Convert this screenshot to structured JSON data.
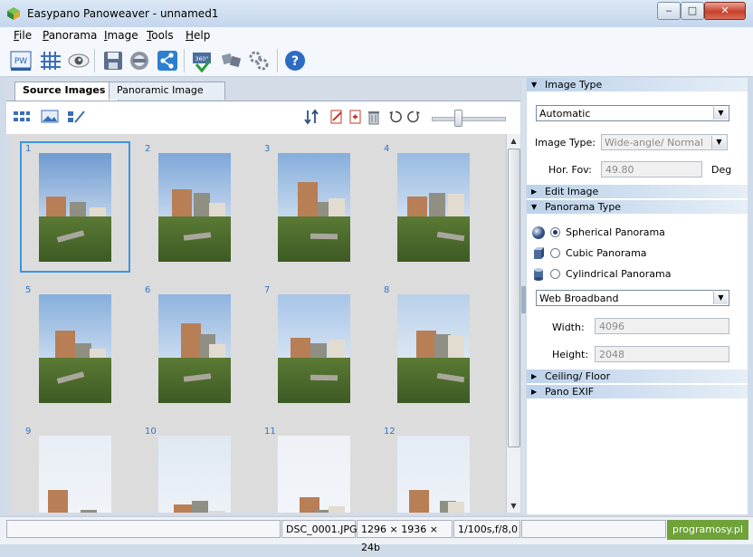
{
  "window": {
    "title": "Easypano Panoweaver - unnamed1",
    "controls": {
      "minimize": "‒",
      "maximize": "□",
      "close": "✕"
    }
  },
  "menu": [
    "File",
    "Panorama",
    "Image",
    "Tools",
    "Help"
  ],
  "toolbar": {
    "icons": [
      "pw-icon",
      "grid-icon",
      "eye-icon",
      "save-icon",
      "360-icon",
      "export-icon",
      "share-icon",
      "publish-360-icon",
      "stitch-icon",
      "batch-stitch-icon",
      "help-icon"
    ],
    "help_glyph": "?",
    "pw_glyph": "PW",
    "deg_glyph": "360°"
  },
  "tabs": {
    "source": "Source Images",
    "panoramic": "Panoramic Image"
  },
  "images": [
    {
      "n": "1",
      "selected": true
    },
    {
      "n": "2"
    },
    {
      "n": "3"
    },
    {
      "n": "4"
    },
    {
      "n": "5"
    },
    {
      "n": "6"
    },
    {
      "n": "7"
    },
    {
      "n": "8"
    },
    {
      "n": "9"
    },
    {
      "n": "10"
    },
    {
      "n": "11"
    },
    {
      "n": "12"
    }
  ],
  "zoom_slider": {
    "value": 0.35
  },
  "right": {
    "image_type_header": "Image Type",
    "image_type_select": "Automatic",
    "image_type_label": "Image Type:",
    "image_type_value": "Wide-angle/ Normal",
    "hor_fov_label": "Hor. Fov:",
    "hor_fov_value": "49.80",
    "hor_fov_unit": "Deg",
    "edit_image_header": "Edit Image",
    "panorama_type_header": "Panorama Type",
    "spherical": "Spherical Panorama",
    "cubic": "Cubic Panorama",
    "cylindrical": "Cylindrical Panorama",
    "output_select": "Web Broadband",
    "width_label": "Width:",
    "width_value": "4096",
    "height_label": "Height:",
    "height_value": "2048",
    "ceiling_header": "Ceiling/ Floor",
    "exif_header": "Pano EXIF",
    "arrow_open": "▼",
    "arrow_closed": "▶",
    "dropdown": "▼"
  },
  "status": {
    "file": "DSC_0001.JPG",
    "dims": "1296 × 1936 × 24b",
    "exif": "1/100s,f/8,0",
    "watermark": "programosy.pl"
  },
  "scroll": {
    "up": "▲",
    "down": "▼"
  },
  "colors": {
    "accent": "#3a96e2",
    "number": "#2f74c9",
    "section": "#bcd2ea"
  }
}
